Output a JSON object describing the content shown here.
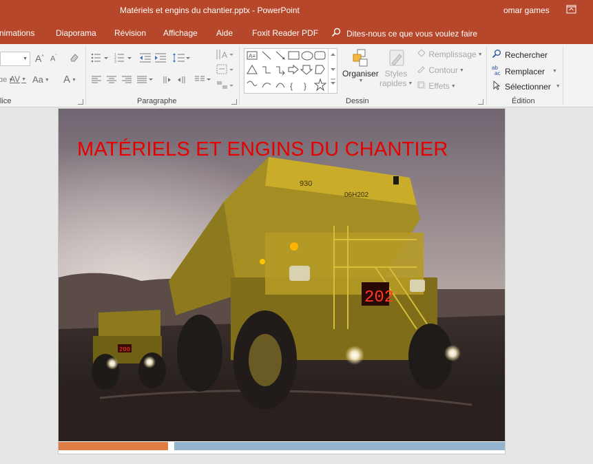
{
  "window": {
    "title": "Matériels et engins du chantier.pptx  -  PowerPoint",
    "user": "omar games"
  },
  "tabs": [
    {
      "label": "nimations"
    },
    {
      "label": "Diaporama"
    },
    {
      "label": "Révision"
    },
    {
      "label": "Affichage"
    },
    {
      "label": "Aide"
    },
    {
      "label": "Foxit Reader PDF"
    }
  ],
  "tell_me": {
    "label": "Dites-nous ce que vous voulez faire"
  },
  "ribbon": {
    "groups": {
      "police": "lice",
      "paragraphe": "Paragraphe",
      "dessin": "Dessin",
      "edition": "Édition"
    },
    "dessin": {
      "organiser": "Organiser",
      "styles_rapides_line1": "Styles",
      "styles_rapides_line2": "rapides",
      "remplissage": "Remplissage",
      "contour": "Contour",
      "effets": "Effets"
    },
    "edition": {
      "rechercher": "Rechercher",
      "remplacer": "Remplacer",
      "selectionner": "Sélectionner"
    },
    "police": {
      "grow": "A",
      "shrink": "A",
      "spacing": "AV",
      "case": "Aa",
      "color": "A"
    }
  },
  "slide": {
    "title": "MATÉRIELS ET ENGINS DU CHANTIER",
    "truck_plate_main": "202",
    "truck_plate_back": "200",
    "truck_label_a": "930",
    "truck_label_b": "06H202"
  },
  "colors": {
    "accent": "#b7472a",
    "slide_title": "#e60000",
    "bar_orange": "#df7d47",
    "bar_blue": "#93b3cf"
  }
}
